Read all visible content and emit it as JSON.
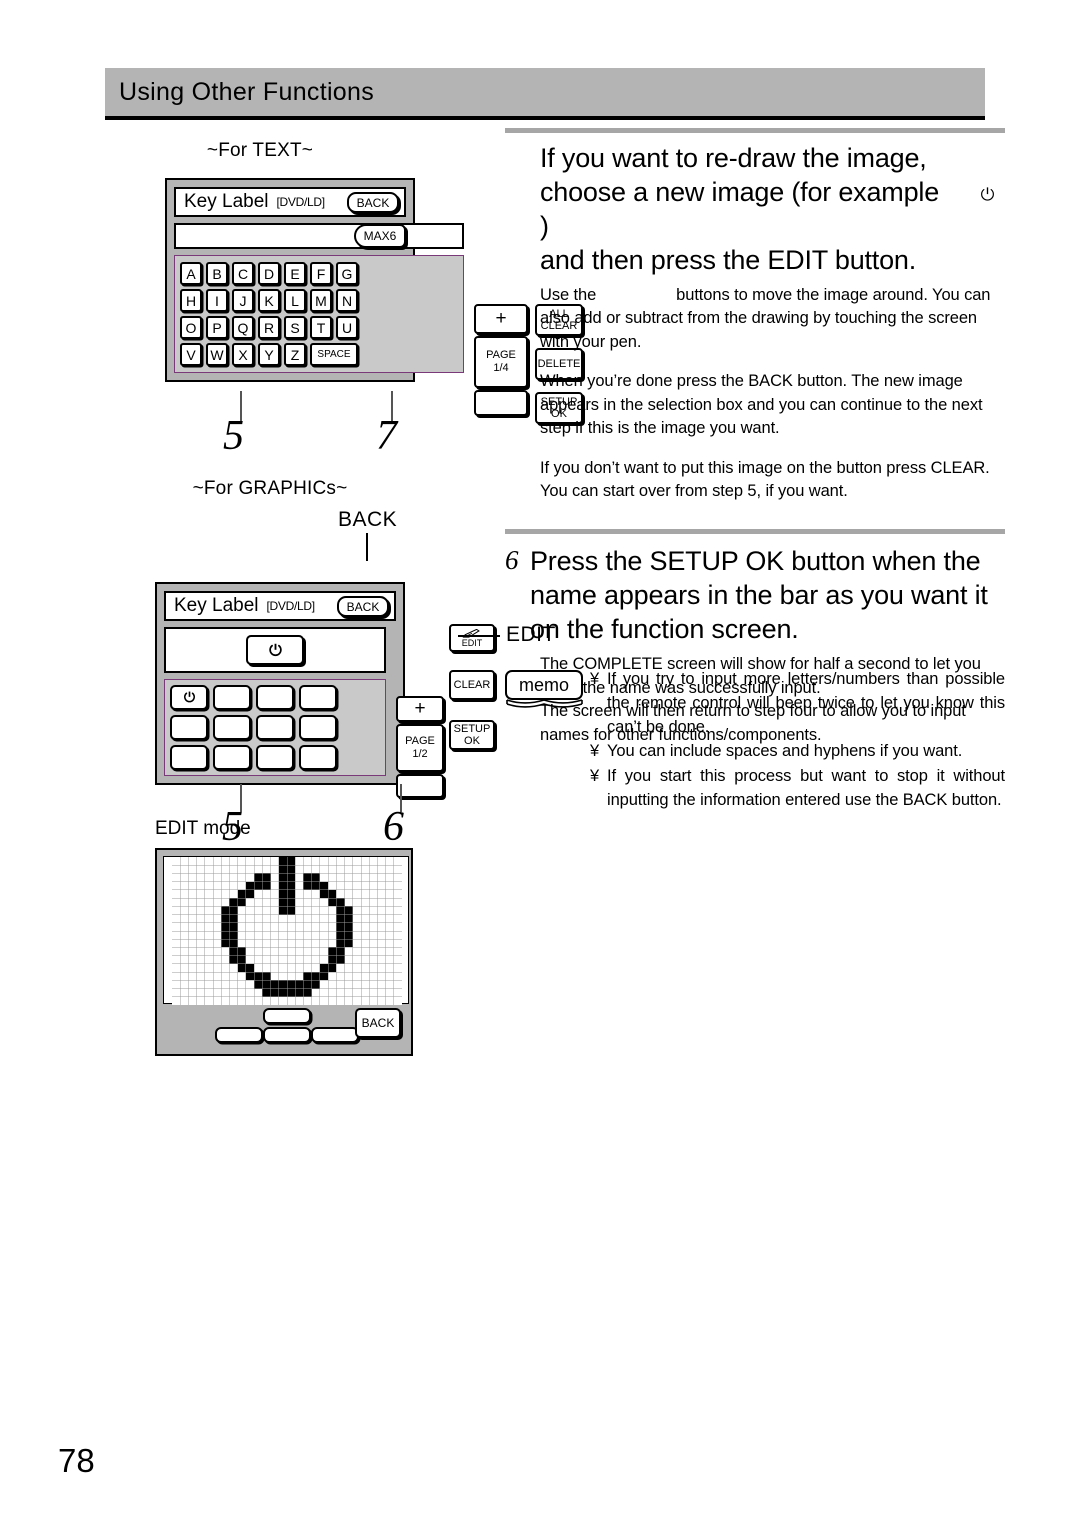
{
  "header": {
    "title": "Using Other Functions"
  },
  "page": {
    "number": "78"
  },
  "left": {
    "text_caption": "~For TEXT~",
    "graphics_caption": "~For GRAPHICs~",
    "editmode_caption": "EDIT mode",
    "text_panel": {
      "title": "Key Label",
      "source": "[DVD/LD]",
      "back_label": "BACK",
      "max_label": "MAX6",
      "input_value": "",
      "keys": [
        [
          "A",
          "B",
          "C",
          "D",
          "E",
          "F",
          "G"
        ],
        [
          "H",
          "I",
          "J",
          "K",
          "L",
          "M",
          "N"
        ],
        [
          "O",
          "P",
          "Q",
          "R",
          "S",
          "T",
          "U"
        ],
        [
          "V",
          "W",
          "X",
          "Y",
          "Z",
          "SPACE"
        ]
      ],
      "plus_label": "+",
      "page_label": "PAGE",
      "page_value": "1/4",
      "all_clear_label": "ALL CLEAR",
      "delete_label": "DELETE",
      "setup_ok_label": "SETUP OK",
      "step_left": "5",
      "step_right": "7"
    },
    "graphics_panel": {
      "title": "Key Label",
      "source": "[DVD/LD]",
      "back_label": "BACK",
      "back_callout": "BACK",
      "edit_label": "EDIT",
      "edit_callout": "EDIT",
      "selected_icon": "power-icon",
      "plus_label": "+",
      "page_label": "PAGE",
      "page_value": "1/2",
      "clear_label": "CLEAR",
      "setup_ok_label": "SETUP OK",
      "step_left": "5",
      "step_right": "6"
    },
    "edit_mode_panel": {
      "back_label": "BACK",
      "drawing": "power-icon-bitmap"
    }
  },
  "right": {
    "section_a": {
      "heading_line1": "If you want to re-draw the image,",
      "heading_line2_pre": "choose a new image (for example",
      "heading_line2_post": ")",
      "heading_icon": "power-icon",
      "heading_line3": "and then press the EDIT button.",
      "para1_pre": "Use the",
      "para1_post": "buttons to move the image around. You can also add or subtract from the drawing by touching the screen with your pen.",
      "para2": "When you’re done press the BACK button. The new image appears in the selection box and you can continue to the next step if this is the image you want.",
      "para3": "If you don’t want to put this image on the button press CLEAR. You can start over from step 5, if you want."
    },
    "section_b": {
      "step": "6",
      "heading": "Press the SETUP OK button when the name appears in the bar as you want it on the function screen.",
      "para1": "The COMPLETE screen will show for half a second to let you know the name was successfully input.",
      "para2": "The screen will then return to step four to allow you to input names for other functions/components."
    },
    "memo": {
      "label": "memo",
      "bullet": "¥",
      "items": [
        "If you try to input more letters/numbers than possible the remote control will beep twice to let you know this can’t be done.",
        "You can include spaces and hyphens if you want.",
        "If you start this process but want to stop it without inputting the information entered use the BACK button."
      ]
    }
  },
  "colors": {
    "header_band": "#b4b4b4",
    "panel_body": "#b4b4b4",
    "keyarea": "#c9c9c9",
    "rule": "#a6a6a6"
  }
}
